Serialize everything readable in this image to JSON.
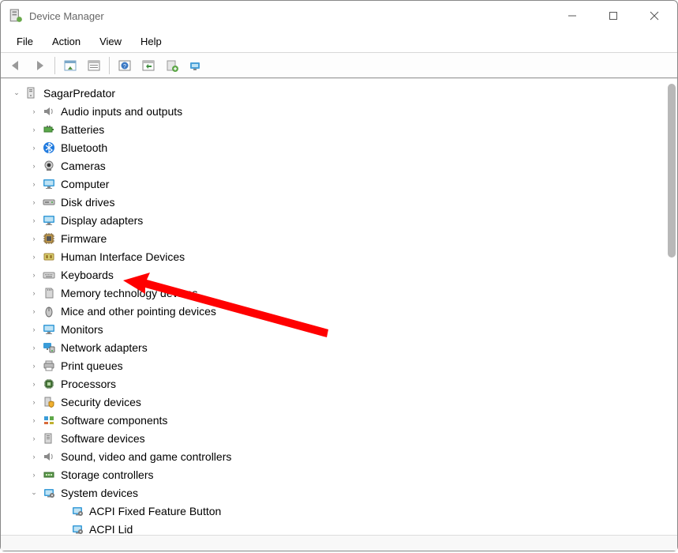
{
  "window": {
    "title": "Device Manager"
  },
  "menubar": {
    "file": "File",
    "action": "Action",
    "view": "View",
    "help": "Help"
  },
  "tree": {
    "root": "SagarPredator",
    "categories": [
      {
        "id": "audio",
        "label": "Audio inputs and outputs",
        "expandable": true
      },
      {
        "id": "batteries",
        "label": "Batteries",
        "expandable": true
      },
      {
        "id": "bluetooth",
        "label": "Bluetooth",
        "expandable": true
      },
      {
        "id": "cameras",
        "label": "Cameras",
        "expandable": true
      },
      {
        "id": "computer",
        "label": "Computer",
        "expandable": true
      },
      {
        "id": "disk",
        "label": "Disk drives",
        "expandable": true
      },
      {
        "id": "display",
        "label": "Display adapters",
        "expandable": true
      },
      {
        "id": "firmware",
        "label": "Firmware",
        "expandable": true
      },
      {
        "id": "hid",
        "label": "Human Interface Devices",
        "expandable": true
      },
      {
        "id": "keyboards",
        "label": "Keyboards",
        "expandable": true
      },
      {
        "id": "memory",
        "label": "Memory technology devices",
        "expandable": true
      },
      {
        "id": "mice",
        "label": "Mice and other pointing devices",
        "expandable": true
      },
      {
        "id": "monitors",
        "label": "Monitors",
        "expandable": true
      },
      {
        "id": "network",
        "label": "Network adapters",
        "expandable": true
      },
      {
        "id": "printers",
        "label": "Print queues",
        "expandable": true
      },
      {
        "id": "processors",
        "label": "Processors",
        "expandable": true
      },
      {
        "id": "security",
        "label": "Security devices",
        "expandable": true
      },
      {
        "id": "swcomponents",
        "label": "Software components",
        "expandable": true
      },
      {
        "id": "swdevices",
        "label": "Software devices",
        "expandable": true
      },
      {
        "id": "sound",
        "label": "Sound, video and game controllers",
        "expandable": true
      },
      {
        "id": "storage",
        "label": "Storage controllers",
        "expandable": true
      },
      {
        "id": "system",
        "label": "System devices",
        "expandable": true,
        "expanded": true,
        "children": [
          {
            "id": "acpi-fixed",
            "label": "ACPI Fixed Feature Button"
          },
          {
            "id": "acpi-lid",
            "label": "ACPI Lid"
          }
        ]
      }
    ]
  },
  "icons": {
    "root": "computer-tower-icon",
    "audio": "speaker-icon",
    "batteries": "battery-plug-icon",
    "bluetooth": "bluetooth-icon",
    "cameras": "webcam-icon",
    "computer": "monitor-icon",
    "disk": "drive-icon",
    "display": "monitor-icon",
    "firmware": "chip-icon",
    "hid": "hid-icon",
    "keyboards": "keyboard-icon",
    "memory": "memcard-icon",
    "mice": "mouse-icon",
    "monitors": "monitor-icon",
    "network": "network-icon",
    "printers": "printer-icon",
    "processors": "cpu-icon",
    "security": "shield-device-icon",
    "swcomponents": "components-icon",
    "swdevices": "swdevice-icon",
    "sound": "speaker-icon",
    "storage": "controller-icon",
    "system": "system-device-icon",
    "child": "system-device-icon"
  },
  "annotation": {
    "type": "arrow",
    "color": "#ff0000",
    "points_to": "disk"
  }
}
